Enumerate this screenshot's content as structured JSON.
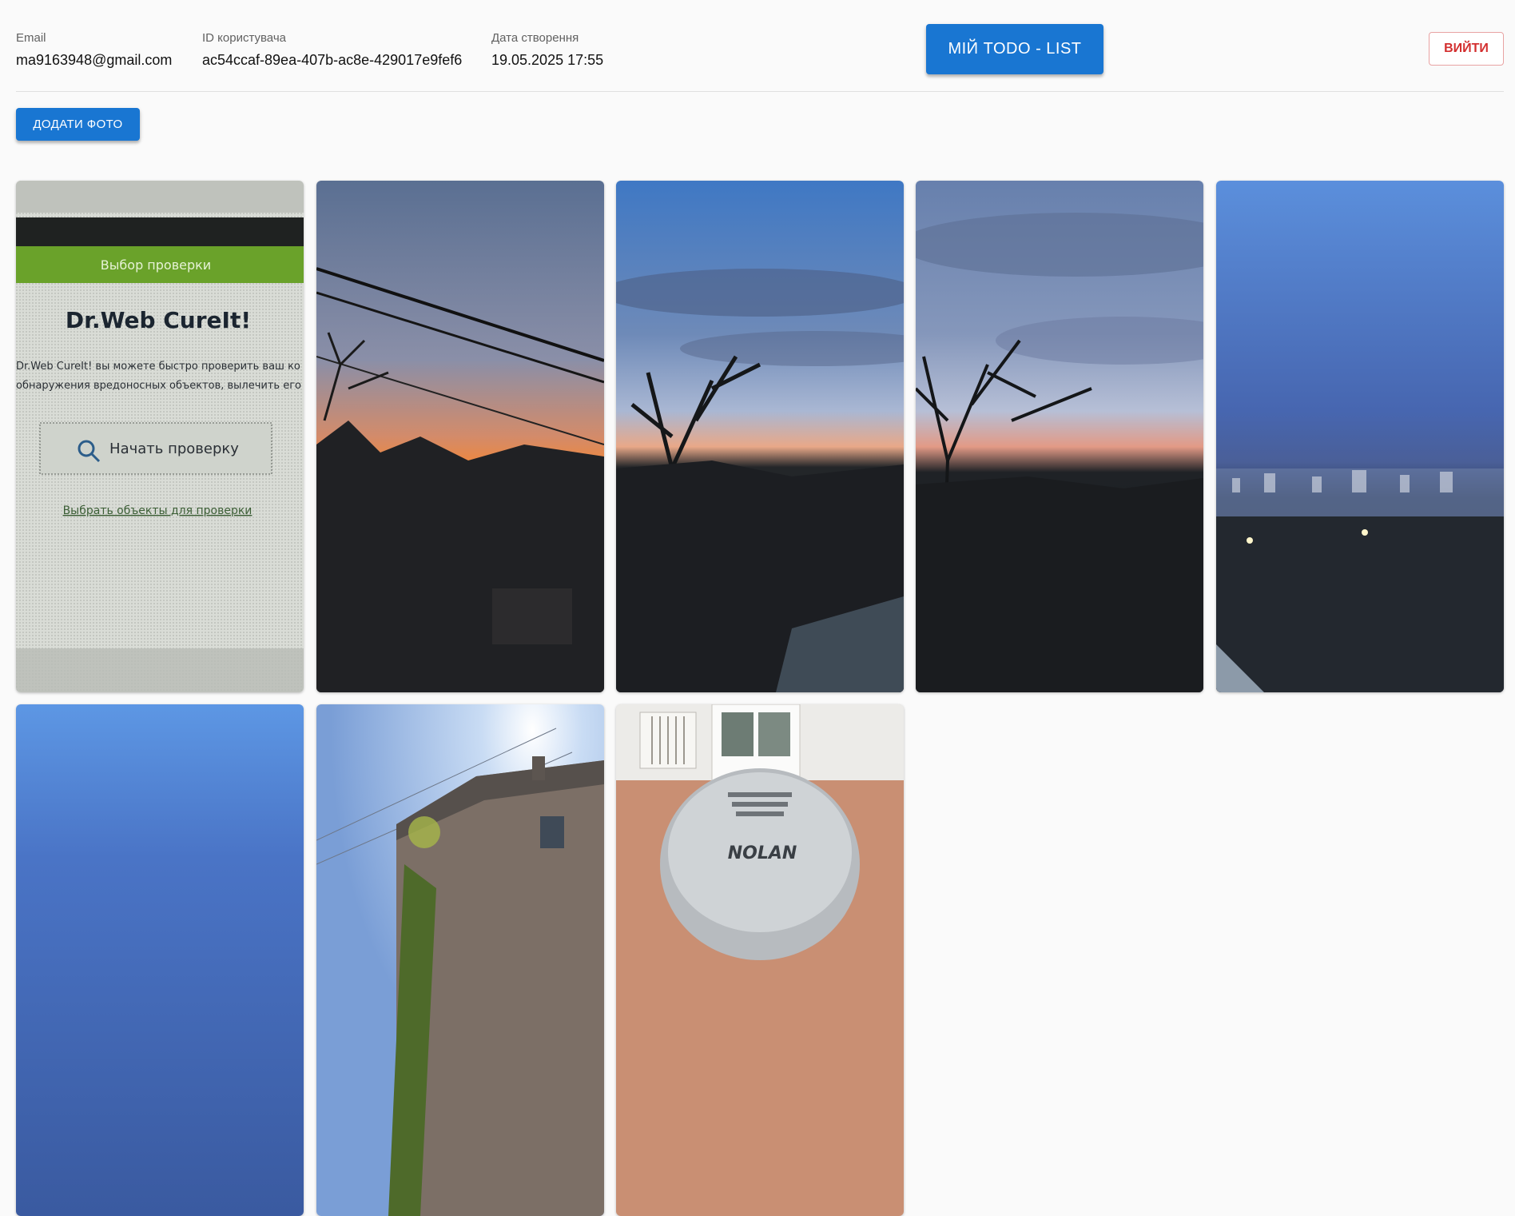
{
  "user": {
    "email_label": "Email",
    "email_value": "ma9163948@gmail.com",
    "id_label": "ID користувача",
    "id_value": "ac54ccaf-89ea-407b-ac8e-429017e9fef6",
    "created_label": "Дата створення",
    "created_value": "19.05.2025 17:55"
  },
  "actions": {
    "todo_label": "МІЙ TODO - LIST",
    "logout_label": "ВИЙТИ",
    "add_photo_label": "ДОДАТИ ФОТО"
  },
  "photos": [
    {
      "subject": "drweb-screen-photo",
      "screen_banner": "Выбор проверки",
      "screen_title": "Dr.Web CureIt!",
      "screen_line1": "Dr.Web CureIt! вы можете быстро проверить ваш ко",
      "screen_line2": "обнаружения вредоносных объектов, вылечить его",
      "screen_button": "Начать проверку",
      "screen_link": "Выбрать объекты для проверки"
    },
    {
      "subject": "sunset-power-lines"
    },
    {
      "subject": "blue-sky-tree-silhouette"
    },
    {
      "subject": "cloudy-sunset-tree"
    },
    {
      "subject": "evening-city-view"
    },
    {
      "subject": "blue-sky"
    },
    {
      "subject": "house-bright-sky"
    },
    {
      "subject": "nolan-helmet",
      "helmet_brand": "NOLAN"
    }
  ],
  "colors": {
    "primary": "#1976d2",
    "danger": "#d32f2f",
    "background": "#fafafa"
  }
}
